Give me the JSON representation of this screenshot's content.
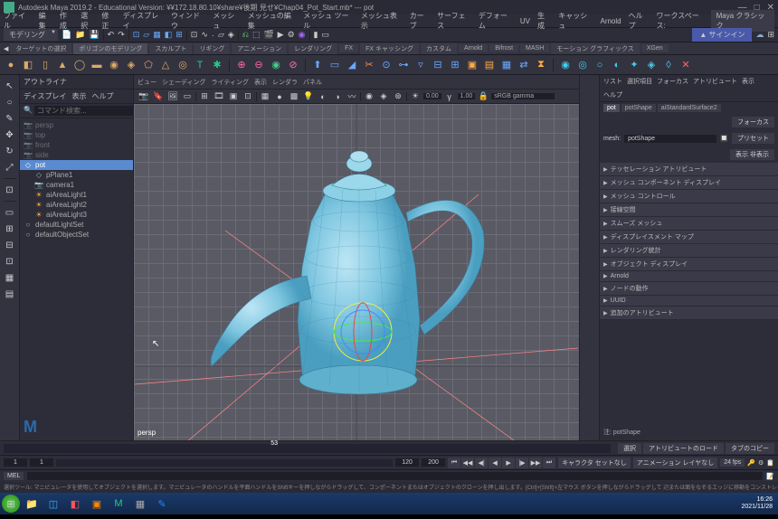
{
  "titlebar": {
    "title": "Autodesk Maya 2019.2 - Educational Version: ¥¥172.18.80.10¥share¥後期 見せ¥Chap04_Pot_Start.mb* --- pot"
  },
  "menubar": {
    "items": [
      "ファイル",
      "編集",
      "作成",
      "選択",
      "修正",
      "ディスプレイ",
      "ウィンドウ",
      "メッシュ",
      "メッシュの編集",
      "メッシュ ツール",
      "メッシュ表示",
      "カーブ",
      "サーフェス",
      "デフォーム",
      "UV",
      "生成",
      "キャッシュ",
      "Arnold",
      "ヘルプ"
    ],
    "workspace_label": "ワークスペース:",
    "workspace": "Maya クラシック"
  },
  "statusbar": {
    "mode": "モデリング",
    "signin": "▲ サインイン"
  },
  "tabbar": [
    "ターゲットの選択",
    "ポリゴンのモデリング",
    "スカルプト",
    "リギング",
    "アニメーション",
    "レンダリング",
    "FX",
    "FX キャッシング",
    "カスタム",
    "Arnold",
    "Bifrost",
    "MASH",
    "モーション グラフィックス",
    "XGen"
  ],
  "outliner": {
    "title": "アウトライナ",
    "menu": [
      "ディスプレイ",
      "表示",
      "ヘルプ"
    ],
    "search_placeholder": "コマンド検索...",
    "items": [
      {
        "icon": "📷",
        "label": "persp",
        "dim": true
      },
      {
        "icon": "📷",
        "label": "top",
        "dim": true
      },
      {
        "icon": "📷",
        "label": "front",
        "dim": true
      },
      {
        "icon": "📷",
        "label": "side",
        "dim": true
      },
      {
        "icon": "◇",
        "label": "pot",
        "selected": true
      },
      {
        "icon": "◇",
        "label": "pPlane1",
        "indent": true
      },
      {
        "icon": "📷",
        "label": "camera1",
        "indent": true
      },
      {
        "icon": "☀",
        "label": "aiAreaLight1",
        "indent": true,
        "color": "#fa4"
      },
      {
        "icon": "☀",
        "label": "aiAreaLight2",
        "indent": true,
        "color": "#fa4"
      },
      {
        "icon": "☀",
        "label": "aiAreaLight3",
        "indent": true,
        "color": "#fa4"
      },
      {
        "icon": "○",
        "label": "defaultLightSet"
      },
      {
        "icon": "○",
        "label": "defaultObjectSet"
      }
    ]
  },
  "viewport": {
    "menu": [
      "ビュー",
      "シェーディング",
      "ライティング",
      "表示",
      "レンダラ",
      "パネル"
    ],
    "field1": "0.00",
    "field2": "1.00",
    "colorspace": "sRGB gamma",
    "camera_label": "persp"
  },
  "attr": {
    "menu": [
      "リスト",
      "選択項目",
      "フォーカス",
      "アトリビュート",
      "表示",
      "ヘルプ"
    ],
    "tabs": [
      "pot",
      "potShape",
      "aiStandardSurface2"
    ],
    "active_tab": "pot",
    "focus_btn": "フォーカス",
    "preset_btn": "プリセット",
    "mesh_label": "mesh:",
    "mesh_value": "potShape",
    "show_btn": "表示  非表示",
    "sections": [
      "テッセレーション アトリビュート",
      "メッシュ コンポーネント ディスプレイ",
      "メッシュ コントロール",
      "接線空間",
      "スムーズ メッシュ",
      "ディスプレイスメント マップ",
      "レンダリング統計",
      "オブジェクト ディスプレイ",
      "Arnold",
      "ノードの動作",
      "UUID",
      "追加のアトリビュート"
    ],
    "note_label": "注:",
    "note_value": "potShape"
  },
  "timeline": {
    "current": "53",
    "btns": [
      "選択",
      "アトリビュートのロード",
      "タブのコピー"
    ]
  },
  "range": {
    "start": "1",
    "end_in": "120",
    "end_out": "120",
    "total": "200",
    "char_label": "キャラクタ セットなし",
    "layer_label": "アニメーション レイヤなし",
    "fps": "24 fps"
  },
  "mel": {
    "label": "MEL"
  },
  "helpline": "選択ツール: マニピュレータを使用してオブジェクトを選択します。マニピュレータのハンドルを平面ハンドルをShiftキーを押しながらドラッグして、コンポーネントまたはオブジェクトのクローンを押し出します。[Ctrl]+[Shift]+左マウス ボタンを押しながらドラッグして 辺または面をなぞるエッジに移動をコンストレインします。[J]または[Insert]キーを使用して、ピボットの位置および方向を変更します。",
  "taskbar": {
    "time": "16:26",
    "date": "2021/11/28"
  }
}
